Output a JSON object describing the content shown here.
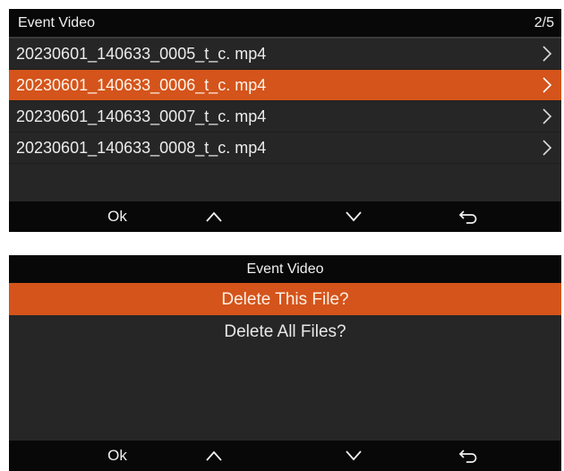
{
  "file_screen": {
    "title": "Event Video",
    "page_indicator": "2/5",
    "files": [
      {
        "name": "20230601_140633_0005_t_c. mp4",
        "selected": false
      },
      {
        "name": "20230601_140633_0006_t_c. mp4",
        "selected": true
      },
      {
        "name": "20230601_140633_0007_t_c. mp4",
        "selected": false
      },
      {
        "name": "20230601_140633_0008_t_c. mp4",
        "selected": false
      }
    ],
    "buttons": {
      "ok": "Ok",
      "up_icon": "chevron-up-icon",
      "down_icon": "chevron-down-icon",
      "back_icon": "return-arrow-icon"
    }
  },
  "delete_screen": {
    "title": "Event Video",
    "options": [
      {
        "label": "Delete This File?",
        "selected": true
      },
      {
        "label": "Delete All Files?",
        "selected": false
      }
    ],
    "buttons": {
      "ok": "Ok",
      "up_icon": "chevron-up-icon",
      "down_icon": "chevron-down-icon",
      "back_icon": "return-arrow-icon"
    }
  },
  "colors": {
    "accent": "#d4541b",
    "background": "#262626",
    "bar": "#080808",
    "text": "#e8e8e8"
  }
}
